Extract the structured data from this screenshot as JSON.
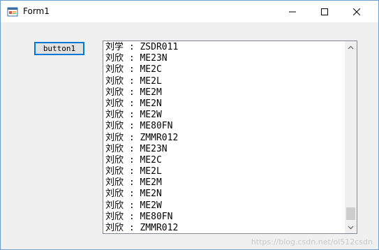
{
  "window": {
    "title": "Form1",
    "controls": {
      "minimize_icon": "minimize-icon",
      "maximize_icon": "maximize-icon",
      "close_icon": "close-icon"
    }
  },
  "button1": {
    "label": "button1"
  },
  "listbox": {
    "items": [
      "刘学 : ZSDR011",
      "刘欣 : ME23N",
      "刘欣 : ME2C",
      "刘欣 : ME2L",
      "刘欣 : ME2M",
      "刘欣 : ME2N",
      "刘欣 : ME2W",
      "刘欣 : ME80FN",
      "刘欣 : ZMMR012",
      "刘欣 : ME23N",
      "刘欣 : ME2C",
      "刘欣 : ME2L",
      "刘欣 : ME2M",
      "刘欣 : ME2N",
      "刘欣 : ME2W",
      "刘欣 : ME80FN",
      "刘欣 : ZMMR012"
    ],
    "scroll_position": 0.93
  },
  "watermark": "https://blog.csdn.net/ol512csdn",
  "colors": {
    "accent": "#0078d7",
    "window_bg": "#f0f0f0",
    "border": "#828790"
  }
}
